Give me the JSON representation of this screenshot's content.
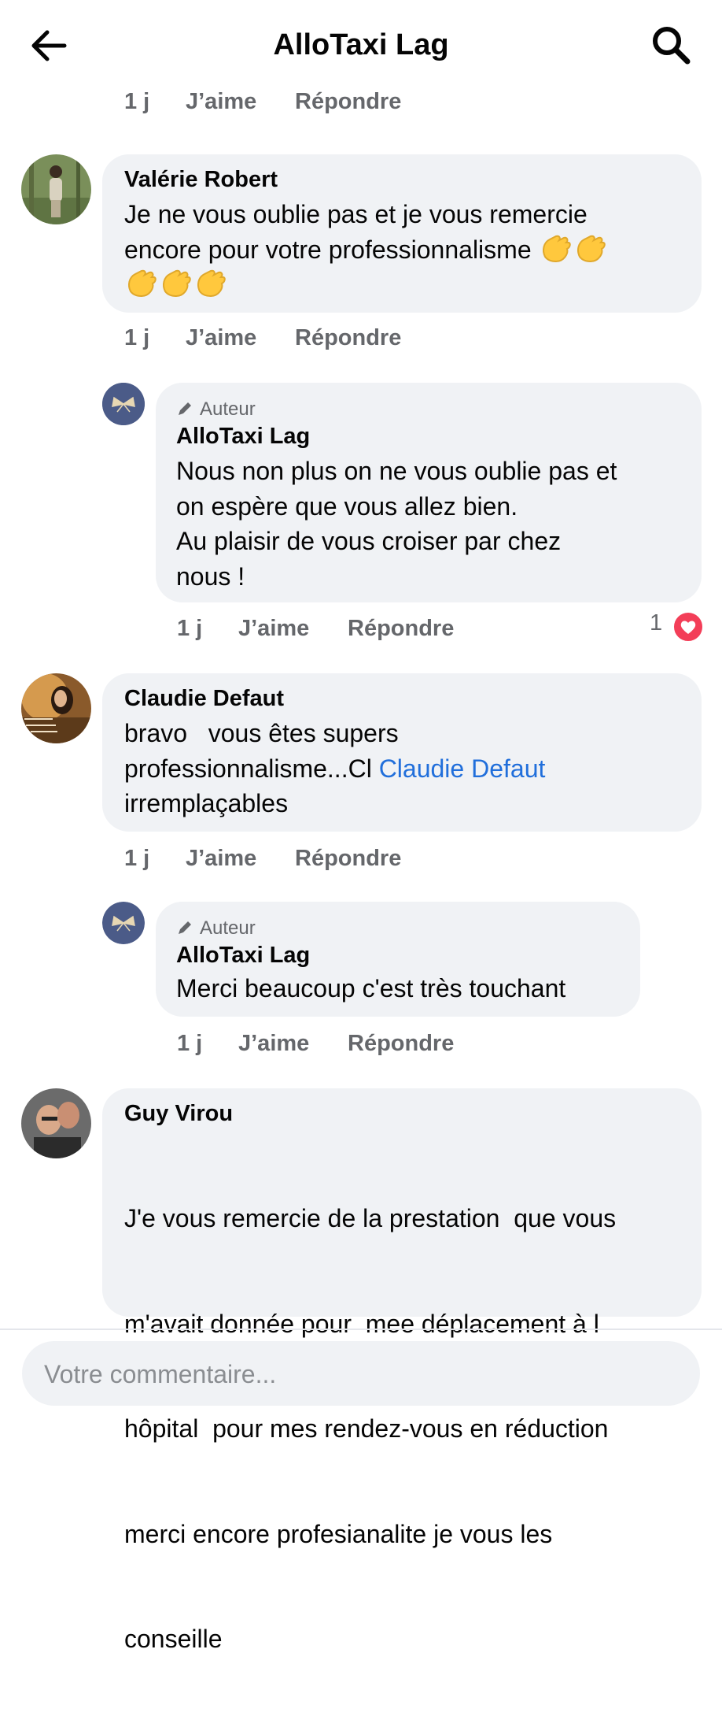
{
  "header": {
    "title": "AlloTaxi Lag",
    "back_icon": "arrow-left-icon",
    "search_icon": "search-icon"
  },
  "top_actions": {
    "time": "1 j",
    "like": "J’aime",
    "reply": "Répondre"
  },
  "comments": [
    {
      "author": "Valérie Robert",
      "line1": "Je ne vous oublie pas et je vous remercie",
      "line2": "encore pour votre professionnalisme",
      "emoji": "👏👏👏👏👏",
      "time": "1 j",
      "like": "J’aime",
      "reply": "Répondre",
      "reply_item": {
        "badge": "Auteur",
        "author": "AlloTaxi Lag",
        "lines": [
          "Nous non plus on ne vous oublie pas et",
          "on espère que vous allez bien.",
          "Au plaisir de vous croiser par chez",
          "nous !"
        ],
        "time": "1 j",
        "like": "J’aime",
        "reply": "Répondre",
        "reaction_count": "1"
      }
    },
    {
      "author": "Claudie Defaut",
      "line1": "bravo   vous êtes supers",
      "line2a": "professionnalisme...Cl ",
      "mention": "Claudie Defaut",
      "line3": "irremplaçables",
      "time": "1 j",
      "like": "J’aime",
      "reply": "Répondre",
      "reply_item": {
        "badge": "Auteur",
        "author": "AlloTaxi Lag",
        "text": "Merci beaucoup c'est très touchant",
        "time": "1 j",
        "like": "J’aime",
        "reply": "Répondre"
      }
    },
    {
      "author": "Guy Virou",
      "lines": [
        "J'e vous remercie de la prestation  que vous",
        "m'avait donnée pour  mee déplacement à l",
        "hôpital  pour mes rendez-vous en réduction",
        "merci encore profesianalite je vous les",
        "conseille"
      ]
    }
  ],
  "composer": {
    "placeholder": "Votre commentaire..."
  },
  "colors": {
    "bubble": "#f0f2f5",
    "meta": "#65676b",
    "mention": "#216fdb",
    "heart": "#f33e58"
  }
}
